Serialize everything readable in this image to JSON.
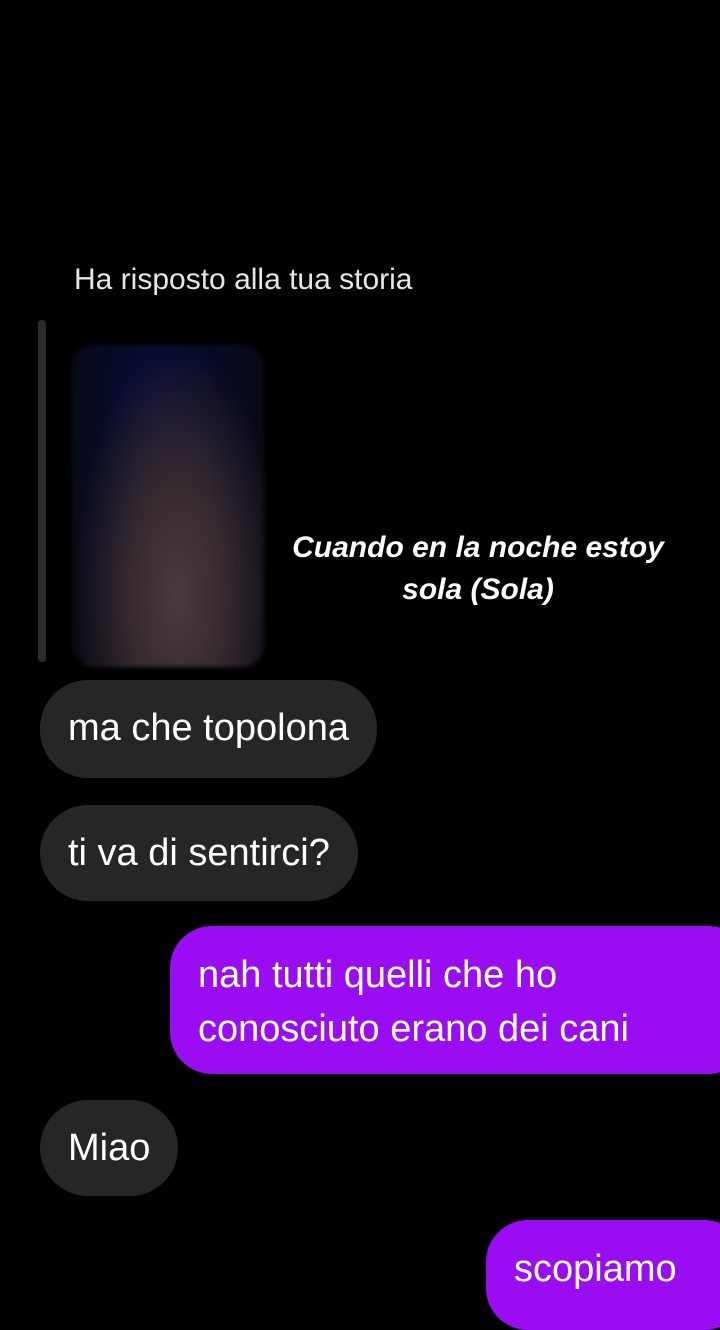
{
  "story_reply": {
    "header": "Ha risposto alla tua storia",
    "caption_line1": "Cuando en la noche estoy",
    "caption_line2": "sola (Sola)"
  },
  "messages": [
    {
      "direction": "incoming",
      "text": "ma che topolona"
    },
    {
      "direction": "incoming",
      "text": "ti va di sentirci?"
    },
    {
      "direction": "outgoing",
      "lines": [
        "nah tutti quelli che ho",
        "conosciuto erano dei cani"
      ]
    },
    {
      "direction": "incoming",
      "text": "Miao"
    },
    {
      "direction": "outgoing",
      "text": "scopiamo"
    }
  ],
  "colors": {
    "background": "#000000",
    "incoming_bubble": "#262626",
    "outgoing_bubble": "#9a0df2",
    "text": "#ffffff"
  }
}
